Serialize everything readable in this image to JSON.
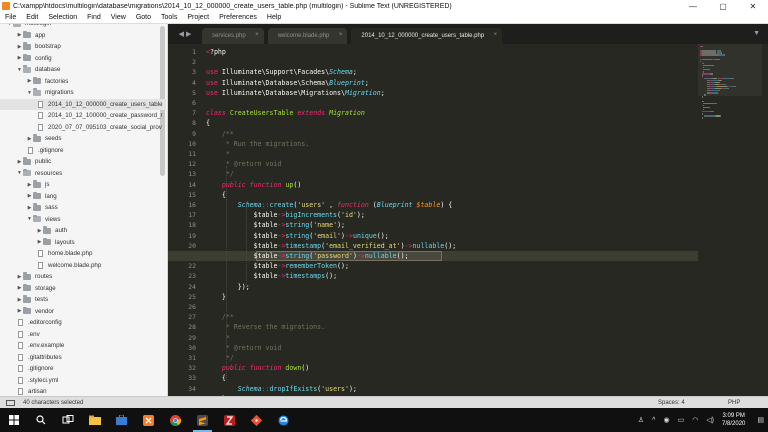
{
  "window": {
    "title": "C:\\xampp\\htdocs\\multilogin\\database\\migrations\\2014_10_12_000000_create_users_table.php (multilogin) - Sublime Text (UNREGISTERED)",
    "minimize": "—",
    "maximize": "▢",
    "close": "✕"
  },
  "menu": [
    "File",
    "Edit",
    "Selection",
    "Find",
    "View",
    "Goto",
    "Tools",
    "Project",
    "Preferences",
    "Help"
  ],
  "sidebar": {
    "items": [
      {
        "label": "multilogin",
        "type": "folder",
        "depth": 0,
        "open": true
      },
      {
        "label": "app",
        "type": "folder",
        "depth": 1,
        "open": false
      },
      {
        "label": "bootstrap",
        "type": "folder",
        "depth": 1,
        "open": false
      },
      {
        "label": "config",
        "type": "folder",
        "depth": 1,
        "open": false
      },
      {
        "label": "database",
        "type": "folder",
        "depth": 1,
        "open": true
      },
      {
        "label": "factories",
        "type": "folder",
        "depth": 2,
        "open": false
      },
      {
        "label": "migrations",
        "type": "folder",
        "depth": 2,
        "open": true
      },
      {
        "label": "2014_10_12_000000_create_users_table",
        "type": "file",
        "depth": 3,
        "selected": true
      },
      {
        "label": "2014_10_12_100000_create_password_r",
        "type": "file",
        "depth": 3
      },
      {
        "label": "2020_07_07_095103_create_social_prov",
        "type": "file",
        "depth": 3
      },
      {
        "label": "seeds",
        "type": "folder",
        "depth": 2,
        "open": false
      },
      {
        "label": ".gitignore",
        "type": "file",
        "depth": 2
      },
      {
        "label": "public",
        "type": "folder",
        "depth": 1,
        "open": false
      },
      {
        "label": "resources",
        "type": "folder",
        "depth": 1,
        "open": true
      },
      {
        "label": "js",
        "type": "folder",
        "depth": 2,
        "open": false
      },
      {
        "label": "lang",
        "type": "folder",
        "depth": 2,
        "open": false
      },
      {
        "label": "sass",
        "type": "folder",
        "depth": 2,
        "open": false
      },
      {
        "label": "views",
        "type": "folder",
        "depth": 2,
        "open": true
      },
      {
        "label": "auth",
        "type": "folder",
        "depth": 3,
        "open": false
      },
      {
        "label": "layouts",
        "type": "folder",
        "depth": 3,
        "open": false
      },
      {
        "label": "home.blade.php",
        "type": "file",
        "depth": 3
      },
      {
        "label": "welcome.blade.php",
        "type": "file",
        "depth": 3
      },
      {
        "label": "routes",
        "type": "folder",
        "depth": 1,
        "open": false
      },
      {
        "label": "storage",
        "type": "folder",
        "depth": 1,
        "open": false
      },
      {
        "label": "tests",
        "type": "folder",
        "depth": 1,
        "open": false
      },
      {
        "label": "vendor",
        "type": "folder",
        "depth": 1,
        "open": false
      },
      {
        "label": ".editorconfig",
        "type": "file",
        "depth": 1
      },
      {
        "label": ".env",
        "type": "file",
        "depth": 1
      },
      {
        "label": ".env.example",
        "type": "file",
        "depth": 1
      },
      {
        "label": ".gitattributes",
        "type": "file",
        "depth": 1
      },
      {
        "label": ".gitignore",
        "type": "file",
        "depth": 1
      },
      {
        "label": ".styleci.yml",
        "type": "file",
        "depth": 1
      },
      {
        "label": "artisan",
        "type": "file",
        "depth": 1
      }
    ]
  },
  "tabs": [
    {
      "label": "services.php",
      "active": false
    },
    {
      "label": "welcome.blade.php",
      "active": false
    },
    {
      "label": "2014_10_12_000000_create_users_table.php",
      "active": true
    }
  ],
  "tab_nav": "◀ ▶",
  "tab_dropdown": "▼",
  "editor": {
    "first_line_number": 1,
    "current_line": 21,
    "lines": [
      [
        [
          "k",
          "<"
        ],
        [
          "",
          "?php"
        ]
      ],
      [],
      [
        [
          "k",
          "use "
        ],
        [
          "",
          "Illuminate\\Support\\Facades\\"
        ],
        [
          "f it",
          "Schema"
        ],
        [
          "",
          ";"
        ]
      ],
      [
        [
          "k",
          "use "
        ],
        [
          "",
          "Illuminate\\Database\\Schema\\"
        ],
        [
          "f it",
          "Blueprint"
        ],
        [
          "",
          ";"
        ]
      ],
      [
        [
          "k",
          "use "
        ],
        [
          "",
          "Illuminate\\Database\\Migrations\\"
        ],
        [
          "f it",
          "Migration"
        ],
        [
          "",
          ";"
        ]
      ],
      [],
      [
        [
          "k it",
          "class "
        ],
        [
          "cl",
          "CreateUsersTable "
        ],
        [
          "k it",
          "extends "
        ],
        [
          "cl it",
          "Migration"
        ]
      ],
      [
        [
          "",
          "{"
        ]
      ],
      [
        [
          "c",
          "    /**"
        ]
      ],
      [
        [
          "c",
          "     * Run the migrations."
        ]
      ],
      [
        [
          "c",
          "     *"
        ]
      ],
      [
        [
          "c",
          "     * @return void"
        ]
      ],
      [
        [
          "c",
          "     */"
        ]
      ],
      [
        [
          "k it",
          "    public function "
        ],
        [
          "cl",
          "up"
        ],
        [
          "",
          "()"
        ]
      ],
      [
        [
          "",
          "    {"
        ]
      ],
      [
        [
          "f it",
          "        Schema"
        ],
        [
          "k",
          "::"
        ],
        [
          "f",
          "create"
        ],
        [
          "",
          "("
        ],
        [
          "s",
          "'users'"
        ],
        [
          "",
          " , "
        ],
        [
          "k it",
          "function "
        ],
        [
          "",
          "("
        ],
        [
          "f it",
          "Blueprint "
        ],
        [
          "v it",
          "$table"
        ],
        [
          "",
          ") {"
        ]
      ],
      [
        [
          "",
          "            $table"
        ],
        [
          "k",
          "->"
        ],
        [
          "f",
          "bigIncrements"
        ],
        [
          "",
          "("
        ],
        [
          "s",
          "'id'"
        ],
        [
          "",
          ");"
        ]
      ],
      [
        [
          "",
          "            $table"
        ],
        [
          "k",
          "->"
        ],
        [
          "f",
          "string"
        ],
        [
          "",
          "("
        ],
        [
          "s",
          "'name'"
        ],
        [
          "",
          ");"
        ]
      ],
      [
        [
          "",
          "            $table"
        ],
        [
          "k",
          "->"
        ],
        [
          "f",
          "string"
        ],
        [
          "",
          "("
        ],
        [
          "s",
          "'email'"
        ],
        [
          "",
          ")"
        ],
        [
          "k",
          "->"
        ],
        [
          "f",
          "unique"
        ],
        [
          "",
          "();"
        ]
      ],
      [
        [
          "",
          "            $table"
        ],
        [
          "k",
          "->"
        ],
        [
          "f",
          "timestamp"
        ],
        [
          "",
          "("
        ],
        [
          "s",
          "'email_verified_at'"
        ],
        [
          "",
          ")"
        ],
        [
          "k",
          "->"
        ],
        [
          "f",
          "nullable"
        ],
        [
          "",
          "();"
        ]
      ],
      [
        [
          "",
          "            $table"
        ],
        [
          "k",
          "->"
        ],
        [
          "f",
          "string"
        ],
        [
          "",
          "("
        ],
        [
          "s",
          "'password'"
        ],
        [
          "",
          ")"
        ],
        [
          "k",
          "->"
        ],
        [
          "f",
          "nullable"
        ],
        [
          "",
          "();"
        ]
      ],
      [
        [
          "",
          "            $table"
        ],
        [
          "k",
          "->"
        ],
        [
          "f",
          "rememberToken"
        ],
        [
          "",
          "();"
        ]
      ],
      [
        [
          "",
          "            $table"
        ],
        [
          "k",
          "->"
        ],
        [
          "f",
          "timestamps"
        ],
        [
          "",
          "();"
        ]
      ],
      [
        [
          "",
          "        });"
        ]
      ],
      [
        [
          "",
          "    }"
        ]
      ],
      [],
      [
        [
          "c",
          "    /**"
        ]
      ],
      [
        [
          "c",
          "     * Reverse the migrations."
        ]
      ],
      [
        [
          "c",
          "     *"
        ]
      ],
      [
        [
          "c",
          "     * @return void"
        ]
      ],
      [
        [
          "c",
          "     */"
        ]
      ],
      [
        [
          "k it",
          "    public function "
        ],
        [
          "cl",
          "down"
        ],
        [
          "",
          "()"
        ]
      ],
      [
        [
          "",
          "    {"
        ]
      ],
      [
        [
          "f it",
          "        Schema"
        ],
        [
          "k",
          "::"
        ],
        [
          "f",
          "dropIfExists"
        ],
        [
          "",
          "("
        ],
        [
          "s",
          "'users'"
        ],
        [
          "",
          ");"
        ]
      ],
      [
        [
          "",
          "    }"
        ]
      ]
    ]
  },
  "status": {
    "selection": "40 characters selected",
    "spaces": "Spaces: 4",
    "syntax": "PHP"
  },
  "taskbar": {
    "apps": [
      "windows-start-icon",
      "search-icon",
      "task-view-icon",
      "file-explorer-icon",
      "store-icon",
      "xampp-icon",
      "chrome-icon",
      "sublime-text-icon",
      "filezilla-icon",
      "git-icon",
      "edge-icon"
    ],
    "active_app": "sublime-text-icon",
    "time": "3:09 PM",
    "date": "7/8/2020"
  },
  "colors": {
    "editor_bg": "#272822",
    "keyword": "#f92672",
    "string": "#e6db74",
    "comment": "#75715e",
    "function": "#66d9ef",
    "class": "#a6e22e",
    "variable": "#fd971f"
  }
}
